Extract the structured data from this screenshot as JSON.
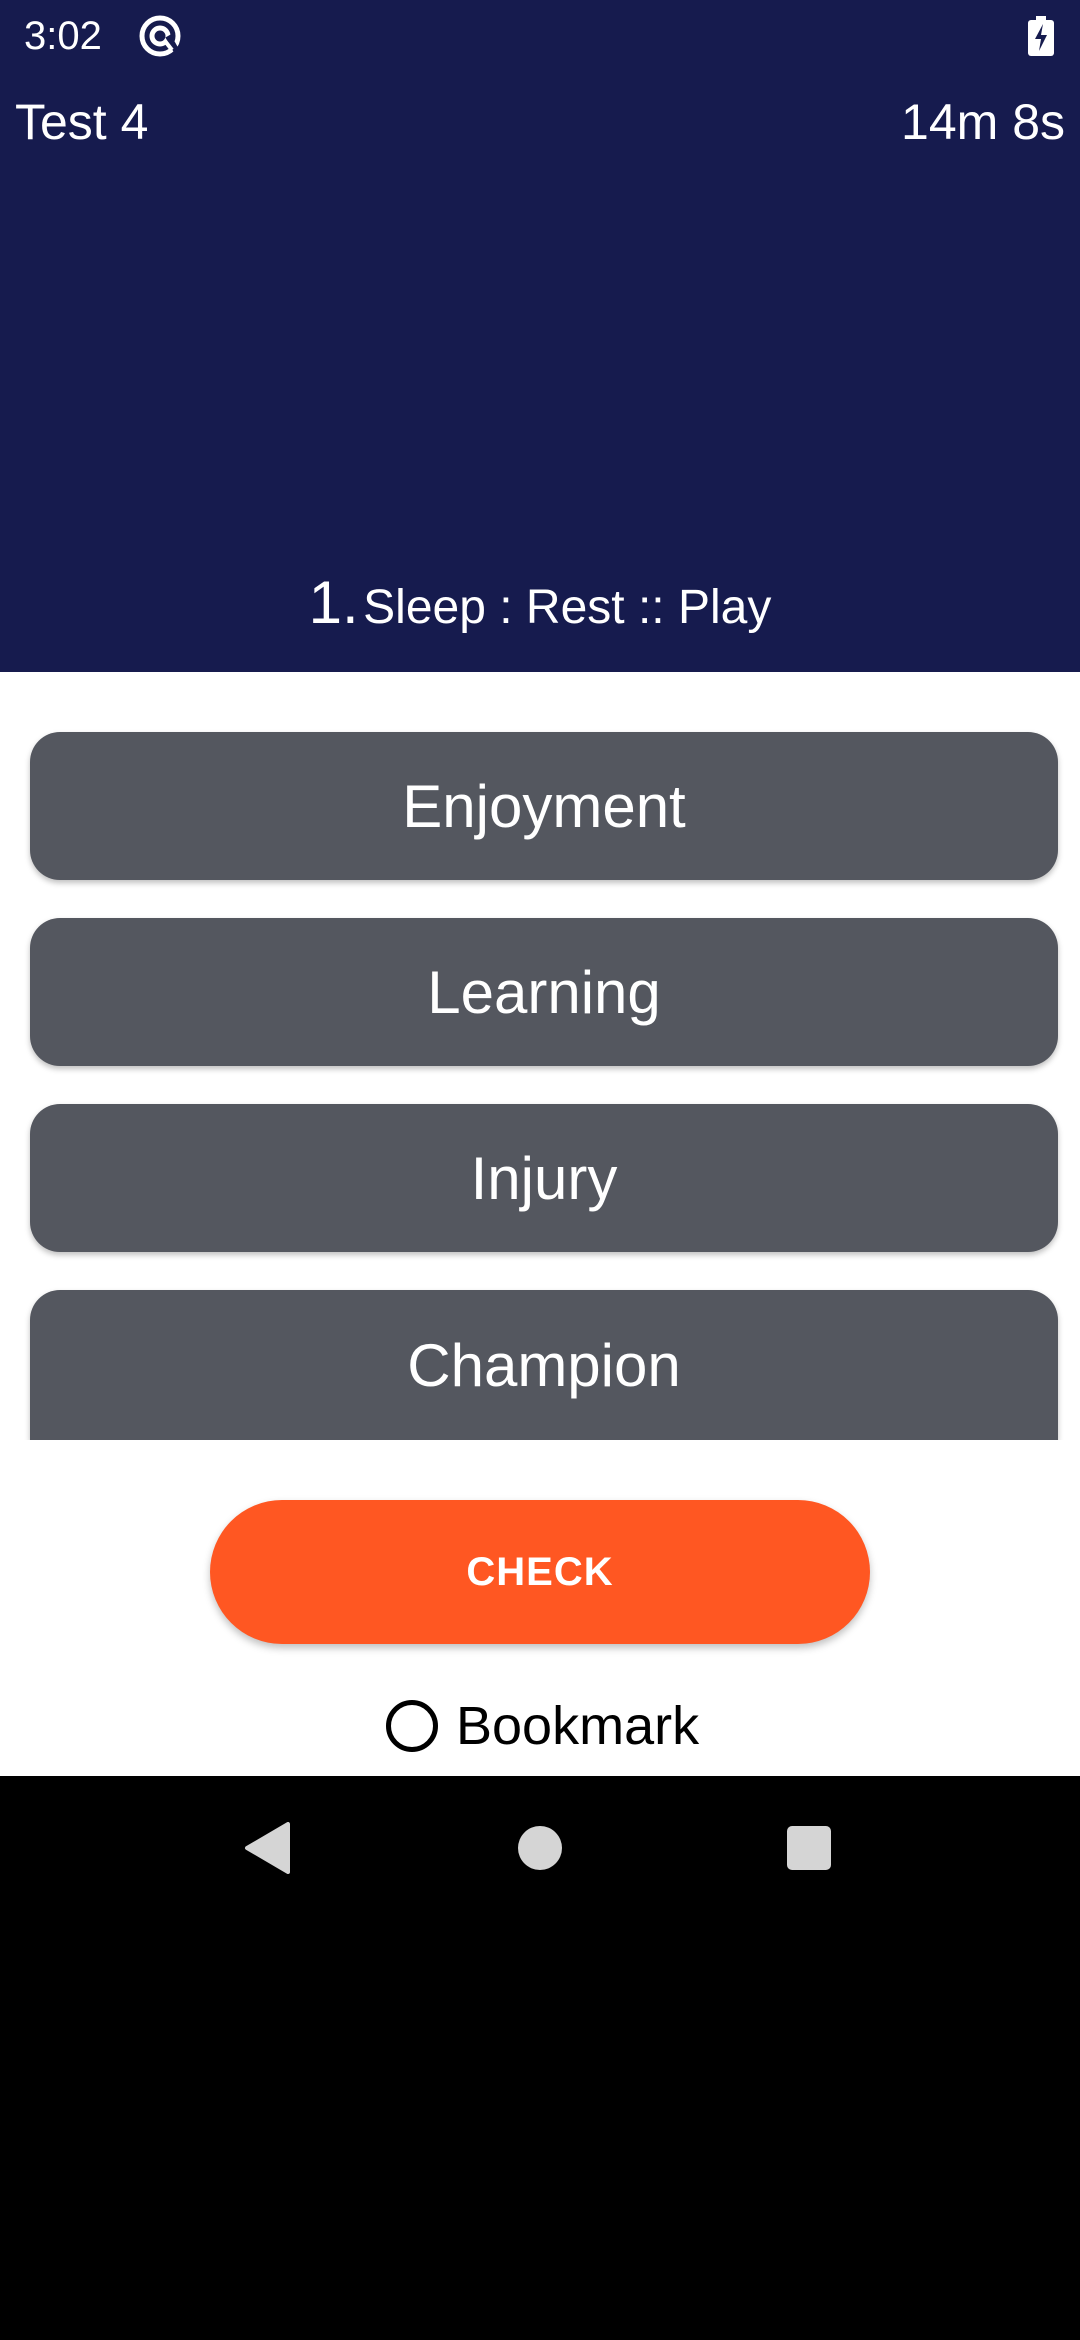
{
  "status_bar": {
    "time": "3:02",
    "app_icon": "at-sign-circle-icon",
    "battery_icon": "battery-charging-icon"
  },
  "header": {
    "test_title": "Test 4",
    "timer": "14m 8s"
  },
  "question": {
    "number": "1.",
    "text": "Sleep : Rest :: Play"
  },
  "options": [
    {
      "label": "Enjoyment"
    },
    {
      "label": "Learning"
    },
    {
      "label": "Injury"
    },
    {
      "label": "Champion"
    }
  ],
  "actions": {
    "check_label": "CHECK",
    "bookmark_label": "Bookmark",
    "bookmark_checked": false
  },
  "navbar": {
    "back_icon": "back-triangle-icon",
    "home_icon": "home-circle-icon",
    "recents_icon": "recents-square-icon"
  },
  "colors": {
    "header_bg": "#161b4e",
    "option_bg": "#54575f",
    "accent": "#ff5722",
    "content_bg": "#ffffff",
    "navbar_bg": "#000000"
  }
}
